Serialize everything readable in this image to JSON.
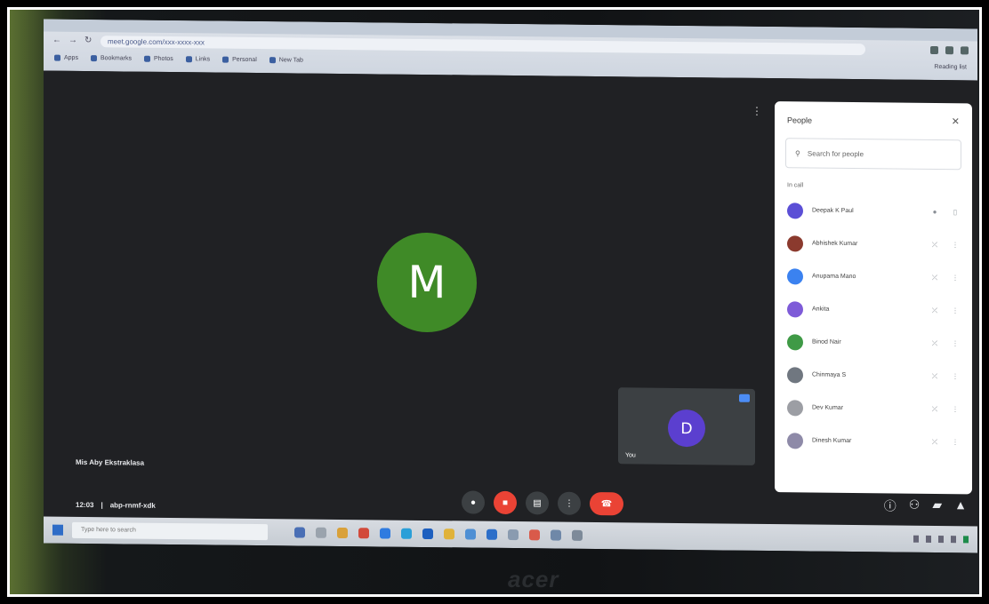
{
  "browser": {
    "url": "meet.google.com/xxx-xxxx-xxx",
    "bookmarks": [
      "Apps",
      "Bookmarks",
      "Photos",
      "Links",
      "Personal",
      "New Tab"
    ],
    "reading_list": "Reading list"
  },
  "stage": {
    "main_initial": "M",
    "self_initial": "D",
    "self_label": "You",
    "meeting_title": "Mis Aby Ekstraklasa",
    "time": "12:03",
    "meeting_code": "abp-rnmf-xdk"
  },
  "controls": {
    "mic_icon": "mic-off-icon",
    "cam_icon": "camera-off-icon",
    "captions_icon": "captions-icon",
    "more_icon": "more-options-icon",
    "end_icon": "end-call-icon"
  },
  "panel": {
    "title": "People",
    "search_placeholder": "Search for people",
    "section": "In call",
    "participants": [
      {
        "name": "Deepak K Paul",
        "color": "#5b4fd6"
      },
      {
        "name": "Abhishek Kumar",
        "color": "#8b3a2e"
      },
      {
        "name": "Anupama Mano",
        "color": "#3b82f0"
      },
      {
        "name": "Ankita",
        "color": "#7e5bd8"
      },
      {
        "name": "Binod Nair",
        "color": "#3f9a46"
      },
      {
        "name": "Chinmaya S",
        "color": "#707780"
      },
      {
        "name": "Dev Kumar",
        "color": "#9c9ea4"
      },
      {
        "name": "Dinesh Kumar",
        "color": "#8e8aa8"
      }
    ]
  },
  "taskbar": {
    "search_placeholder": "Type here to search"
  },
  "laptop_brand": "acer"
}
